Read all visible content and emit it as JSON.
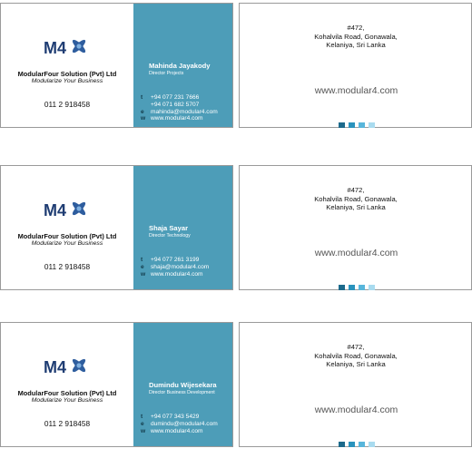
{
  "cards": [
    {
      "front": {
        "logo": "M4",
        "company": "ModularFour Solution (Pvt) Ltd",
        "tagline": "Modularize Your Business",
        "phone": "011 2 918458",
        "name": "Mahinda Jayakody",
        "title": "Director Projects",
        "contacts": [
          {
            "label": "t",
            "value": "+94 077 231 7666"
          },
          {
            "label": "",
            "value": "+94 071 682 5707"
          },
          {
            "label": "e",
            "value": "mahinda@modular4.com"
          },
          {
            "label": "w",
            "value": "www.modular4.com"
          }
        ]
      },
      "back": {
        "address": [
          "#472,",
          "Kohalvila Road, Gonawala,",
          "Kelaniya, Sri Lanka"
        ],
        "website": "www.modular4.com"
      }
    },
    {
      "front": {
        "logo": "M4",
        "company": "ModularFour Solution (Pvt) Ltd",
        "tagline": "Modularize Your Business",
        "phone": "011 2 918458",
        "name": "Shaja Sayar",
        "title": "Director Technology",
        "contacts": [
          {
            "label": "t",
            "value": "+94 077 261 3199"
          },
          {
            "label": "e",
            "value": "shaja@modular4.com"
          },
          {
            "label": "w",
            "value": "www.modular4.com"
          }
        ]
      },
      "back": {
        "address": [
          "#472,",
          "Kohalvila Road, Gonawala,",
          "Kelaniya, Sri Lanka"
        ],
        "website": "www.modular4.com"
      }
    },
    {
      "front": {
        "logo": "M4",
        "company": "ModularFour Solution (Pvt) Ltd",
        "tagline": "Modularize Your Business",
        "phone": "011 2 918458",
        "name": "Dumindu Wijesekara",
        "title": "Director Business Development",
        "contacts": [
          {
            "label": "t",
            "value": "+94 077 343 5429"
          },
          {
            "label": "e",
            "value": "dumindu@modular4.com"
          },
          {
            "label": "w",
            "value": "www.modular4.com"
          }
        ]
      },
      "back": {
        "address": [
          "#472,",
          "Kohalvila Road, Gonawala,",
          "Kelaniya, Sri Lanka"
        ],
        "website": "www.modular4.com"
      }
    }
  ],
  "colors": {
    "card_blue": "#4d9db8",
    "squares": [
      "#1c6a8c",
      "#2a93bd",
      "#58b6db",
      "#a9dbef"
    ],
    "logo_m": "#1f3d73",
    "logo_x": "#2e5d9e"
  }
}
